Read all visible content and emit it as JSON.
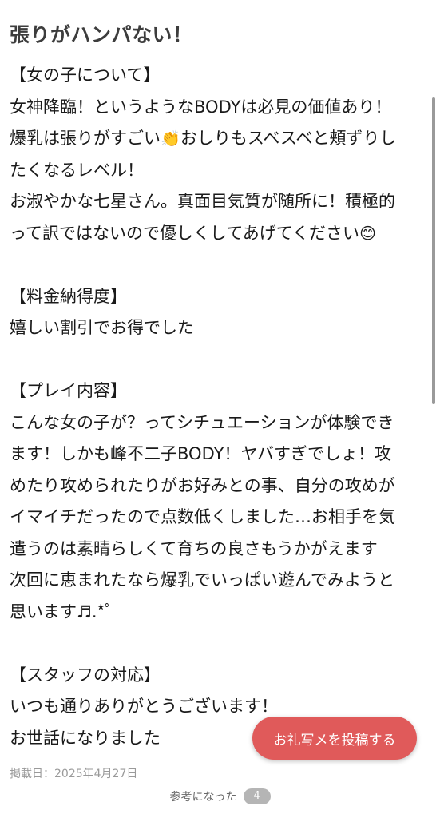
{
  "title": "張りがハンパない！",
  "sections": {
    "girl": {
      "heading": "【女の子について】",
      "line1": "女神降臨！というようなBODYは必見の価値あり！",
      "line2a": "爆乳は張りがすごい",
      "emoji_clap": "👏",
      "line2b": "おしりもスベスベと頬ずりし",
      "line3": "たくなるレベル！",
      "line4": "お淑やかな七星さん。真面目気質が随所に！積極的",
      "line5a": "って訳ではないので優しくしてあげてください",
      "emoji_smile": "😊"
    },
    "price": {
      "heading": "【料金納得度】",
      "line1": "嬉しい割引でお得でした"
    },
    "play": {
      "heading": "【プレイ内容】",
      "line1": "こんな女の子が？ってシチュエーションが体験でき",
      "line2": "ます！しかも峰不二子BODY！ヤバすぎでしょ！攻",
      "line3": "めたり攻められたりがお好みとの事、自分の攻めが",
      "line4": "イマイチだったので点数低くしました…お相手を気",
      "line5": "遣うのは素晴らしくて育ちの良さもうかがえます",
      "line6": "次回に恵まれたなら爆乳でいっぱい遊んでみようと",
      "line7": "思います♬.*ﾟ"
    },
    "staff": {
      "heading": "【スタッフの対応】",
      "line1": "いつも通りありがとうございます！",
      "line2": "お世話になりました"
    }
  },
  "cta_label": "お礼写メを投稿する",
  "posted_date": "掲載日：2025年4月27日",
  "helpful_label": "参考になった",
  "helpful_count": "4"
}
